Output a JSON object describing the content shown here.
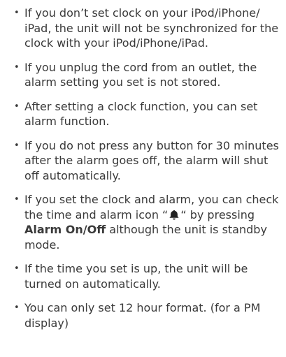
{
  "bullet_glyph": "•",
  "items": [
    {
      "text": "If you don’t set clock on your iPod/iPhone/ iPad, the unit will not be synchronized for the clock with your iPod/iPhone/iPad."
    },
    {
      "text": "If you unplug the cord from an outlet, the alarm setting you set is not stored."
    },
    {
      "text": "After setting a clock function, you can set alarm function."
    },
    {
      "text": "If you do not press any button for 30 minutes after the alarm goes off, the alarm will shut off automatically."
    },
    {
      "text_before_icon": "If you set the clock  and alarm, you can check the time and alarm icon “",
      "icon": "bell-icon",
      "text_after_icon": "“ by pressing",
      "bold_text": "Alarm On/Off",
      "text_after_bold": "although the unit is standby mode."
    },
    {
      "text": "If the time you set  is up, the unit will be turned on automatically."
    },
    {
      "text": "You can only set 12 hour format. (for a PM display)"
    }
  ],
  "text_color": "#3a3a3a"
}
